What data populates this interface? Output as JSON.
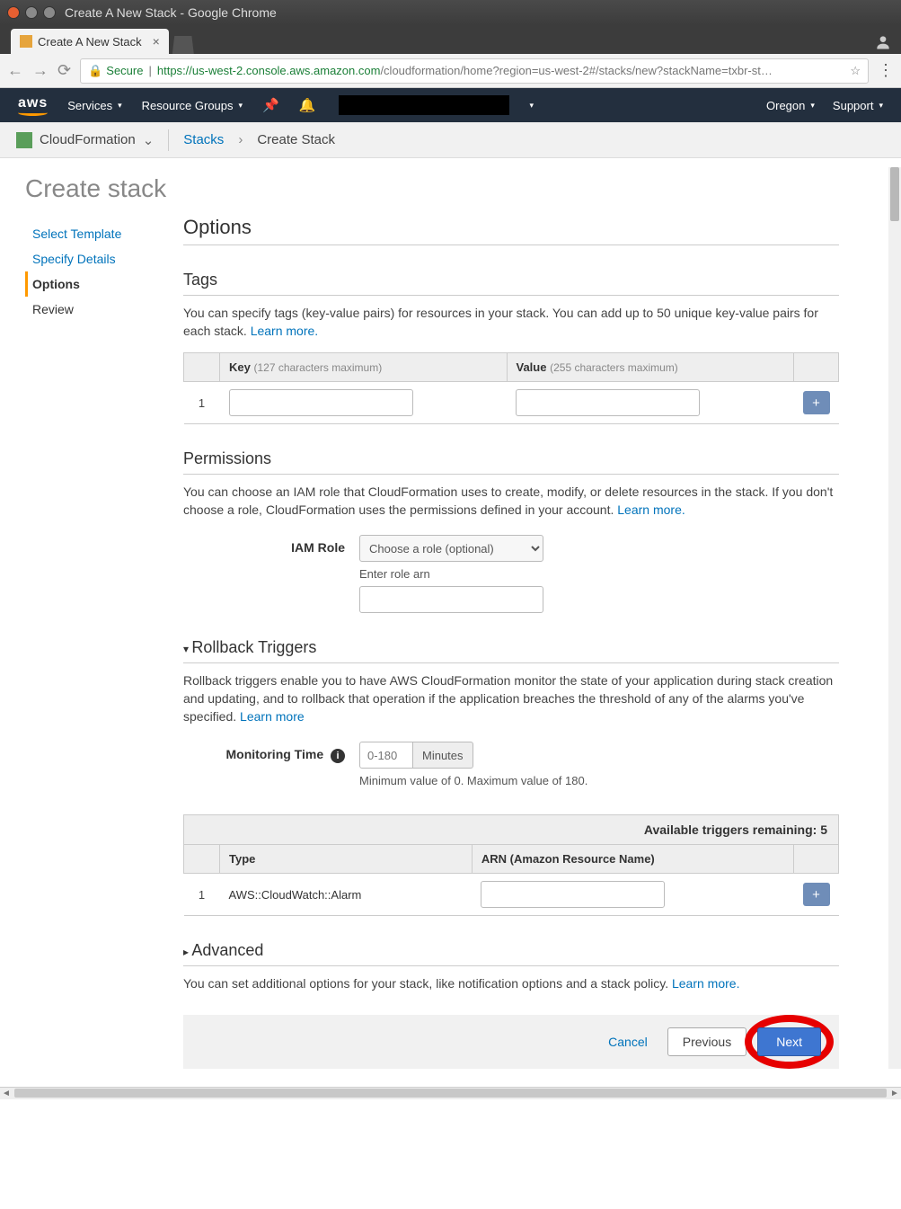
{
  "window": {
    "title": "Create A New Stack - Google Chrome"
  },
  "tab": {
    "title": "Create A New Stack"
  },
  "url": {
    "secure_label": "Secure",
    "scheme": "https",
    "host": "://us-west-2.console.aws.amazon.com",
    "path": "/cloudformation/home?region=us-west-2#/stacks/new?stackName=txbr-st…"
  },
  "aws_nav": {
    "logo": "aws",
    "services": "Services",
    "resource_groups": "Resource Groups",
    "region": "Oregon",
    "support": "Support"
  },
  "breadcrumb": {
    "service": "CloudFormation",
    "stacks": "Stacks",
    "current": "Create Stack"
  },
  "page_title": "Create stack",
  "wizard": {
    "select_template": "Select Template",
    "specify_details": "Specify Details",
    "options": "Options",
    "review": "Review"
  },
  "sections": {
    "options": {
      "title": "Options"
    },
    "tags": {
      "title": "Tags",
      "desc": "You can specify tags (key-value pairs) for resources in your stack. You can add up to 50 unique key-value pairs for each stack. ",
      "learn_more": "Learn more.",
      "col_key": "Key",
      "col_key_hint": "(127 characters maximum)",
      "col_value": "Value",
      "col_value_hint": "(255 characters maximum)",
      "row1_index": "1"
    },
    "permissions": {
      "title": "Permissions",
      "desc": "You can choose an IAM role that CloudFormation uses to create, modify, or delete resources in the stack. If you don't choose a role, CloudFormation uses the permissions defined in your account. ",
      "learn_more": "Learn more.",
      "iam_role_label": "IAM Role",
      "iam_role_placeholder": "Choose a role (optional)",
      "enter_arn_label": "Enter role arn"
    },
    "rollback": {
      "title": "Rollback Triggers",
      "desc": "Rollback triggers enable you to have AWS CloudFormation monitor the state of your application during stack creation and updating, and to rollback that operation if the application breaches the threshold of any of the alarms you've specified. ",
      "learn_more": "Learn more",
      "monitoring_label": "Monitoring Time",
      "monitoring_placeholder": "0-180",
      "monitoring_unit": "Minutes",
      "monitoring_helper": "Minimum value of 0. Maximum value of 180.",
      "remaining": "Available triggers remaining: 5",
      "col_type": "Type",
      "col_arn": "ARN (Amazon Resource Name)",
      "row1_index": "1",
      "row1_type": "AWS::CloudWatch::Alarm"
    },
    "advanced": {
      "title": "Advanced",
      "desc": "You can set additional options for your stack, like notification options and a stack policy. ",
      "learn_more": "Learn more."
    }
  },
  "footer": {
    "cancel": "Cancel",
    "previous": "Previous",
    "next": "Next"
  }
}
